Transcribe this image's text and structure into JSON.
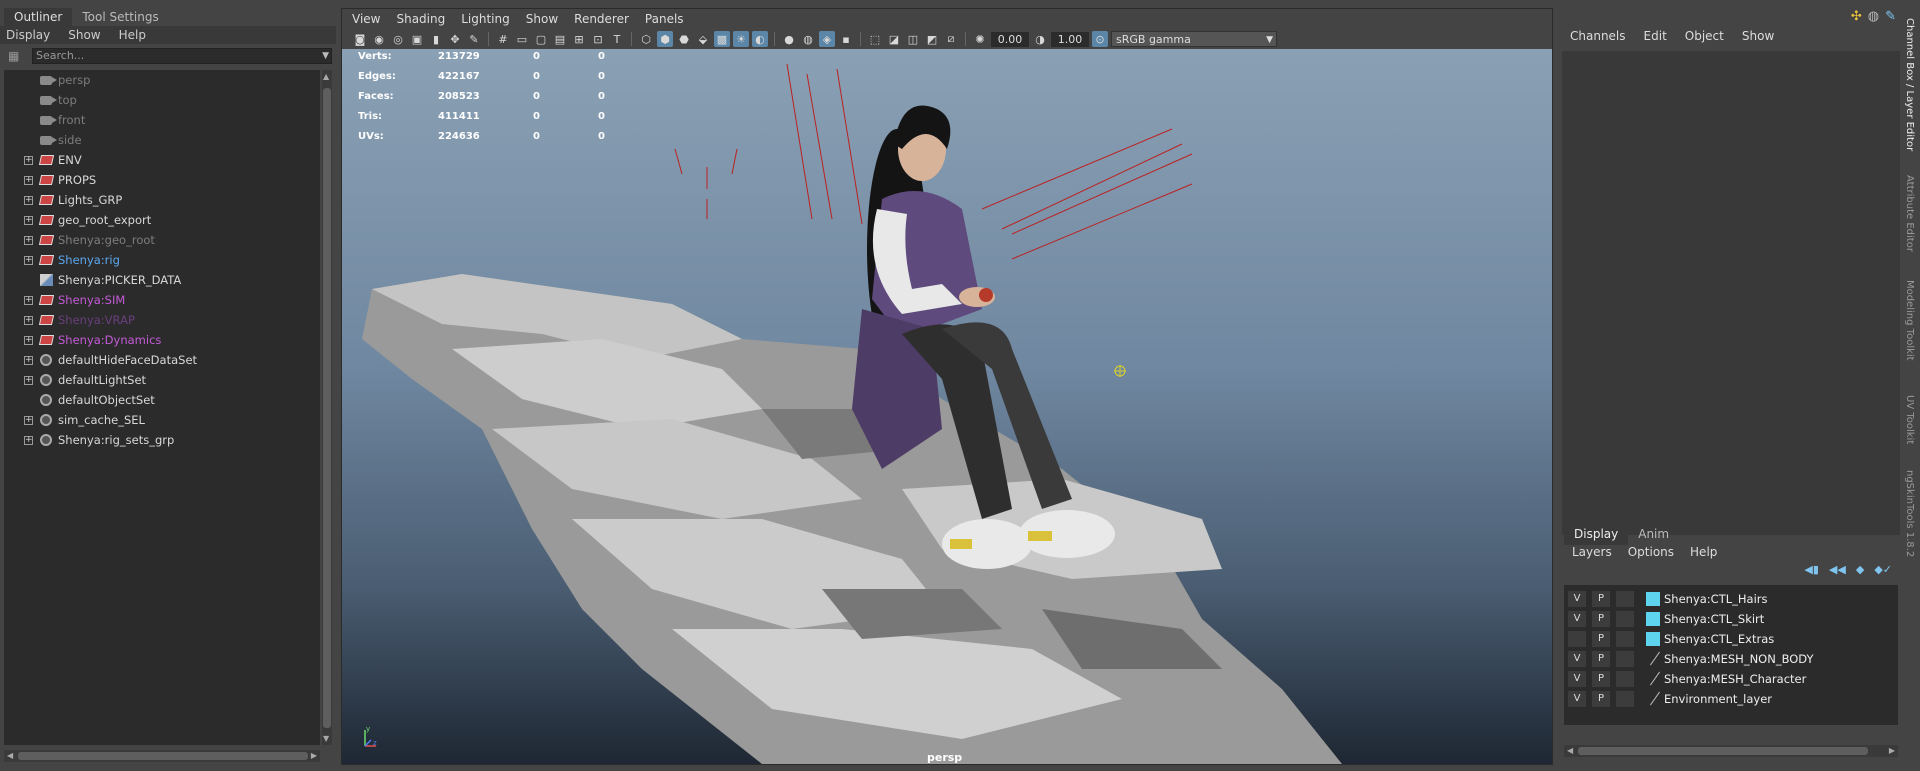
{
  "outliner": {
    "tabs": [
      {
        "label": "Outliner"
      },
      {
        "label": "Tool Settings"
      }
    ],
    "menu": [
      "Display",
      "Show",
      "Help"
    ],
    "search_placeholder": "Search...",
    "items": [
      {
        "label": "persp",
        "icon": "camera-icon",
        "expandable": false,
        "color": "#7d7d7d"
      },
      {
        "label": "top",
        "icon": "camera-icon",
        "expandable": false,
        "color": "#7d7d7d"
      },
      {
        "label": "front",
        "icon": "camera-icon",
        "expandable": false,
        "color": "#7d7d7d"
      },
      {
        "label": "side",
        "icon": "camera-icon",
        "expandable": false,
        "color": "#7d7d7d"
      },
      {
        "label": "ENV",
        "icon": "group-icon",
        "expandable": true,
        "color": "#d8d8d8"
      },
      {
        "label": "PROPS",
        "icon": "group-icon",
        "expandable": true,
        "color": "#d8d8d8"
      },
      {
        "label": "Lights_GRP",
        "icon": "group-icon",
        "expandable": true,
        "color": "#d8d8d8"
      },
      {
        "label": "geo_root_export",
        "icon": "group-icon",
        "expandable": true,
        "color": "#d8d8d8"
      },
      {
        "label": "Shenya:geo_root",
        "icon": "group-icon",
        "expandable": true,
        "color": "#7d7d7d"
      },
      {
        "label": "Shenya:rig",
        "icon": "group-icon",
        "expandable": true,
        "color": "#5ba8f0"
      },
      {
        "label": "Shenya:PICKER_DATA",
        "icon": "picker-icon",
        "expandable": false,
        "color": "#d8d8d8"
      },
      {
        "label": "Shenya:SIM",
        "icon": "group-icon",
        "expandable": true,
        "color": "#c45ad8"
      },
      {
        "label": "Shenya:VRAP",
        "icon": "group-icon",
        "expandable": true,
        "color": "#6a3f7e"
      },
      {
        "label": "Shenya:Dynamics",
        "icon": "group-icon",
        "expandable": true,
        "color": "#c45ad8"
      },
      {
        "label": "defaultHideFaceDataSet",
        "icon": "set-icon",
        "expandable": true,
        "color": "#d8d8d8"
      },
      {
        "label": "defaultLightSet",
        "icon": "set-icon",
        "expandable": true,
        "color": "#d8d8d8"
      },
      {
        "label": "defaultObjectSet",
        "icon": "set-icon",
        "expandable": false,
        "color": "#d8d8d8"
      },
      {
        "label": "sim_cache_SEL",
        "icon": "set-icon",
        "expandable": true,
        "color": "#d8d8d8"
      },
      {
        "label": "Shenya:rig_sets_grp",
        "icon": "set-icon",
        "expandable": true,
        "color": "#d8d8d8"
      }
    ]
  },
  "viewport": {
    "menu": [
      "View",
      "Shading",
      "Lighting",
      "Show",
      "Renderer",
      "Panels"
    ],
    "exposure": "0.00",
    "gamma": "1.00",
    "color_space": "sRGB gamma",
    "camera_label": "persp",
    "hud": [
      {
        "label": "Verts:",
        "total": "213729",
        "sel": "0",
        "comp": "0"
      },
      {
        "label": "Edges:",
        "total": "422167",
        "sel": "0",
        "comp": "0"
      },
      {
        "label": "Faces:",
        "total": "208523",
        "sel": "0",
        "comp": "0"
      },
      {
        "label": "Tris:",
        "total": "411411",
        "sel": "0",
        "comp": "0"
      },
      {
        "label": "UVs:",
        "total": "224636",
        "sel": "0",
        "comp": "0"
      }
    ],
    "axis": {
      "x": "x",
      "y": "y",
      "z": "z"
    }
  },
  "channel_box": {
    "menu": [
      "Channels",
      "Edit",
      "Object",
      "Show"
    ]
  },
  "layer_editor": {
    "tabs": [
      {
        "label": "Display"
      },
      {
        "label": "Anim"
      }
    ],
    "menu": [
      "Layers",
      "Options",
      "Help"
    ],
    "layers": [
      {
        "v": "V",
        "p": "P",
        "name": "Shenya:CTL_Hairs",
        "color": "#5fd4ef"
      },
      {
        "v": "V",
        "p": "P",
        "name": "Shenya:CTL_Skirt",
        "color": "#5fd4ef"
      },
      {
        "v": "",
        "p": "P",
        "name": "Shenya:CTL_Extras",
        "color": "#5fd4ef"
      },
      {
        "v": "V",
        "p": "P",
        "name": "Shenya:MESH_NON_BODY",
        "color": ""
      },
      {
        "v": "V",
        "p": "P",
        "name": "Shenya:MESH_Character",
        "color": ""
      },
      {
        "v": "V",
        "p": "P",
        "name": "Environment_layer",
        "color": ""
      }
    ]
  },
  "side_tabs": [
    "Channel Box / Layer Editor",
    "Attribute Editor",
    "Modeling Toolkit",
    "UV Toolkit",
    "ngSkinTools 1.8.2"
  ]
}
